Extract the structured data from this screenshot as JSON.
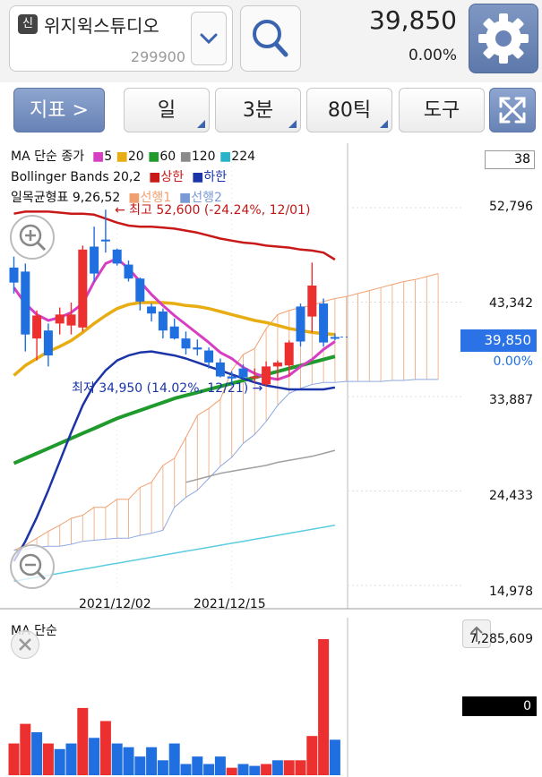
{
  "header": {
    "badge": "신",
    "stock_name": "위지윅스튜디오",
    "stock_code": "299900",
    "price": "39,850",
    "change_pct": "0.00%"
  },
  "toolbar": {
    "indicator_label": "지표  >",
    "period_label": "일",
    "minute_label": "3분",
    "tick_label": "80틱",
    "tools_label": "도구"
  },
  "legend": {
    "ma_title": "MA 단순 종가",
    "ma_periods": [
      {
        "label": "5",
        "color": "#d63fc1"
      },
      {
        "label": "20",
        "color": "#e8ad12"
      },
      {
        "label": "60",
        "color": "#1f9a2c"
      },
      {
        "label": "120",
        "color": "#8a8a8a"
      },
      {
        "label": "224",
        "color": "#29b3c9"
      }
    ],
    "bb_title": "Bollinger Bands 20,2",
    "bb_upper": "상한",
    "bb_lower": "하한",
    "ichimoku_title": "일목균형표 9,26,52",
    "ich_lead1": "선행1",
    "ich_lead2": "선행2"
  },
  "annotations": {
    "high": "← 최고 52,600 (-24.24%, 12/01)",
    "low": "최저 34,950 (14.02%, 12/21) →"
  },
  "axis": {
    "top_value": "38",
    "y1": "52,796",
    "y2": "43,342",
    "current": "39,850",
    "current_pct": "0.00%",
    "y3": "33,887",
    "y4": "24,433",
    "y5": "14,978",
    "x1": "2021/12/02",
    "x2": "2021/12/15"
  },
  "volume": {
    "title": "MA 단순",
    "max": "7,285,609",
    "zero": "0"
  },
  "colors": {
    "up": "#ec2f2f",
    "down": "#1f6fe0",
    "bb_upper": "#c91818",
    "bb_lower": "#1b35a8",
    "accent": "#6a84b8"
  },
  "chart_data": {
    "type": "candlestick",
    "yrange": [
      14978,
      54000
    ],
    "candles": [
      {
        "o": 46800,
        "h": 47900,
        "l": 44200,
        "c": 45300
      },
      {
        "o": 46400,
        "h": 47200,
        "l": 38400,
        "c": 40100
      },
      {
        "o": 39700,
        "h": 42500,
        "l": 37500,
        "c": 42000
      },
      {
        "o": 40500,
        "h": 41200,
        "l": 36900,
        "c": 38000
      },
      {
        "o": 41200,
        "h": 42800,
        "l": 40100,
        "c": 42100
      },
      {
        "o": 41000,
        "h": 43300,
        "l": 40100,
        "c": 42100
      },
      {
        "o": 40800,
        "h": 49000,
        "l": 40400,
        "c": 48600
      },
      {
        "o": 48900,
        "h": 50900,
        "l": 45400,
        "c": 46200
      },
      {
        "o": 49600,
        "h": 52600,
        "l": 48300,
        "c": 49600
      },
      {
        "o": 48600,
        "h": 48700,
        "l": 47000,
        "c": 47200
      },
      {
        "o": 47100,
        "h": 47500,
        "l": 45400,
        "c": 45700
      },
      {
        "o": 45700,
        "h": 45800,
        "l": 42500,
        "c": 43400
      },
      {
        "o": 42900,
        "h": 43200,
        "l": 41400,
        "c": 42200
      },
      {
        "o": 42400,
        "h": 42700,
        "l": 39700,
        "c": 40500
      },
      {
        "o": 40900,
        "h": 41700,
        "l": 39600,
        "c": 39700
      },
      {
        "o": 39700,
        "h": 40400,
        "l": 38100,
        "c": 38700
      },
      {
        "o": 38800,
        "h": 39600,
        "l": 38000,
        "c": 38600
      },
      {
        "o": 38500,
        "h": 38800,
        "l": 36700,
        "c": 37300
      },
      {
        "o": 37300,
        "h": 37700,
        "l": 35800,
        "c": 35900
      },
      {
        "o": 35900,
        "h": 36400,
        "l": 35000,
        "c": 35700
      },
      {
        "o": 36700,
        "h": 37100,
        "l": 35700,
        "c": 35800
      },
      {
        "o": 35800,
        "h": 36700,
        "l": 35300,
        "c": 35900
      },
      {
        "o": 35100,
        "h": 37400,
        "l": 34950,
        "c": 36900
      },
      {
        "o": 36900,
        "h": 37500,
        "l": 35500,
        "c": 37300
      },
      {
        "o": 37000,
        "h": 39500,
        "l": 35900,
        "c": 39300
      },
      {
        "o": 42900,
        "h": 43200,
        "l": 38900,
        "c": 39400
      },
      {
        "o": 41900,
        "h": 47300,
        "l": 40300,
        "c": 45000
      },
      {
        "o": 43200,
        "h": 43700,
        "l": 38900,
        "c": 39300
      },
      {
        "o": 39850,
        "h": 40200,
        "l": 39500,
        "c": 39850
      }
    ],
    "ma5": [
      44800,
      43200,
      42100,
      41500,
      41800,
      42300,
      43200,
      45400,
      47200,
      47700,
      46700,
      45400,
      44100,
      43000,
      42000,
      41100,
      40200,
      39300,
      38300,
      37700,
      36800,
      36200,
      35800,
      35600,
      36000,
      36900,
      37600,
      38600,
      39400
    ],
    "ma20": [
      36000,
      37000,
      37700,
      38400,
      38900,
      39500,
      40300,
      41200,
      42000,
      42700,
      43100,
      43300,
      43300,
      43300,
      43200,
      43000,
      42900,
      42700,
      42400,
      42100,
      41800,
      41500,
      41300,
      41000,
      40700,
      40500,
      40300,
      40200,
      40100
    ],
    "ma60": [
      27200,
      27700,
      28200,
      28700,
      29200,
      29700,
      30200,
      30700,
      31200,
      31700,
      32100,
      32500,
      32900,
      33300,
      33700,
      34000,
      34300,
      34600,
      34900,
      35200,
      35500,
      35800,
      36100,
      36400,
      36700,
      37000,
      37300,
      37600,
      37900
    ],
    "ma120": [
      null,
      null,
      null,
      null,
      null,
      null,
      null,
      null,
      null,
      null,
      null,
      null,
      null,
      null,
      null,
      25300,
      25600,
      25900,
      26200,
      26400,
      26600,
      26800,
      27000,
      27300,
      27500,
      27700,
      27900,
      28200,
      28500
    ],
    "ma224": [
      15400,
      15600,
      15800,
      16000,
      16200,
      16400,
      16600,
      16800,
      17000,
      17200,
      17400,
      17600,
      17800,
      18000,
      18200,
      18400,
      18600,
      18800,
      19000,
      19200,
      19400,
      19600,
      19800,
      20000,
      20200,
      20400,
      20600,
      20800,
      21000
    ],
    "bb_upper": [
      52200,
      52400,
      52400,
      52400,
      52300,
      52200,
      52200,
      52100,
      51700,
      51300,
      51000,
      50900,
      50900,
      50800,
      50700,
      50500,
      50300,
      50000,
      49700,
      49500,
      49300,
      49200,
      49000,
      48900,
      48800,
      48600,
      48500,
      48300,
      47600
    ],
    "bb_lower": [
      17400,
      19400,
      21800,
      24500,
      27400,
      30300,
      33000,
      35100,
      36500,
      37500,
      38000,
      38300,
      38400,
      38200,
      38000,
      37700,
      37300,
      36900,
      36500,
      36100,
      35700,
      35300,
      35000,
      34800,
      34600,
      34600,
      34600,
      34600,
      34800
    ],
    "ich_lead1": [
      18500,
      19000,
      19700,
      20400,
      21000,
      21700,
      22000,
      22800,
      22800,
      23600,
      23600,
      24800,
      25300,
      27000,
      27700,
      29800,
      32000,
      32700,
      33600,
      36500,
      38100,
      38700,
      40700,
      42100,
      42500,
      42800,
      43000,
      43400,
      43700,
      43900,
      44200,
      44500,
      44800,
      45100,
      45400,
      45600,
      45900,
      46200
    ],
    "ich_lead2": [
      18500,
      18600,
      18800,
      18900,
      18900,
      19100,
      19400,
      19500,
      19600,
      19700,
      19700,
      20000,
      20200,
      20500,
      22800,
      23800,
      24500,
      25700,
      26900,
      27800,
      29200,
      30100,
      31400,
      33000,
      34200,
      34700,
      35100,
      35300,
      35300,
      35400,
      35400,
      35400,
      35400,
      35500,
      35500,
      35600,
      35600,
      35600
    ],
    "volume": {
      "max": 7285609,
      "bars": [
        {
          "v": 1700000,
          "up": true
        },
        {
          "v": 2750000,
          "up": true
        },
        {
          "v": 2300000,
          "up": false
        },
        {
          "v": 1700000,
          "up": true
        },
        {
          "v": 1400000,
          "up": false
        },
        {
          "v": 1700000,
          "up": false
        },
        {
          "v": 3600000,
          "up": true
        },
        {
          "v": 2000000,
          "up": false
        },
        {
          "v": 2900000,
          "up": true
        },
        {
          "v": 1700000,
          "up": false
        },
        {
          "v": 1500000,
          "up": false
        },
        {
          "v": 1000000,
          "up": false
        },
        {
          "v": 1500000,
          "up": false
        },
        {
          "v": 800000,
          "up": false
        },
        {
          "v": 1700000,
          "up": false
        },
        {
          "v": 600000,
          "up": false
        },
        {
          "v": 1000000,
          "up": false
        },
        {
          "v": 600000,
          "up": false
        },
        {
          "v": 1000000,
          "up": false
        },
        {
          "v": 400000,
          "up": true
        },
        {
          "v": 600000,
          "up": false
        },
        {
          "v": 500000,
          "up": false
        },
        {
          "v": 600000,
          "up": true
        },
        {
          "v": 800000,
          "up": false
        },
        {
          "v": 800000,
          "up": true
        },
        {
          "v": 800000,
          "up": true
        },
        {
          "v": 2100000,
          "up": true
        },
        {
          "v": 7285609,
          "up": true
        },
        {
          "v": 1900000,
          "up": false
        }
      ]
    }
  }
}
